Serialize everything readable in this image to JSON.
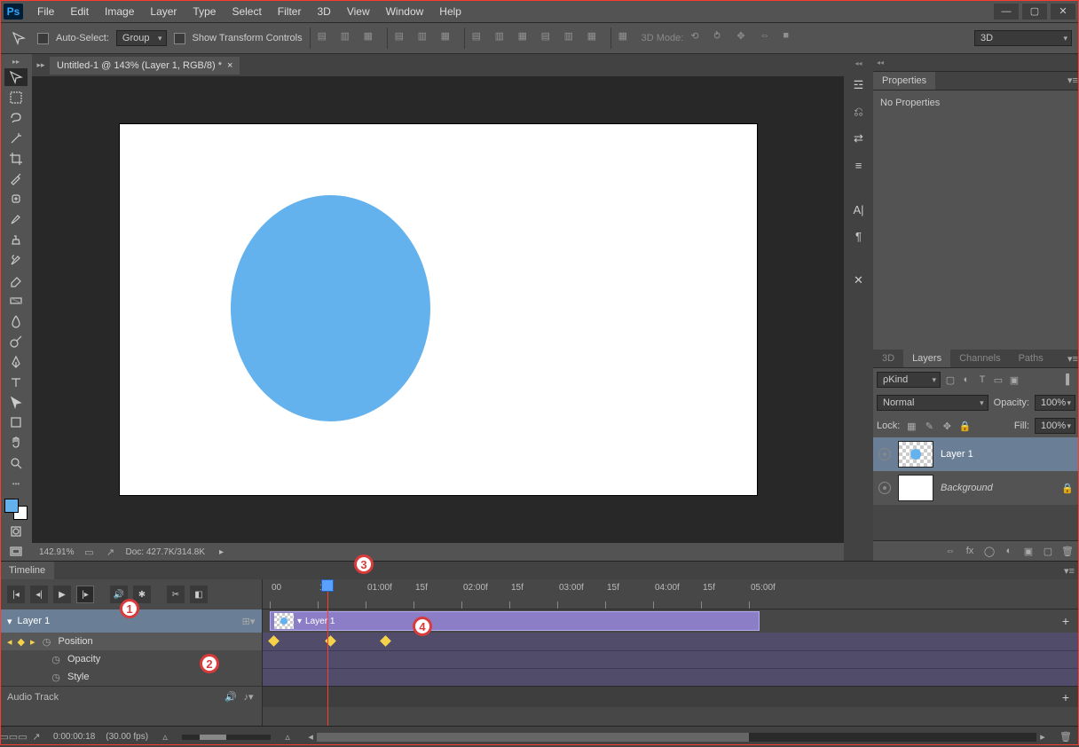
{
  "menubar": {
    "items": [
      "File",
      "Edit",
      "Image",
      "Layer",
      "Type",
      "Select",
      "Filter",
      "3D",
      "View",
      "Window",
      "Help"
    ]
  },
  "optionsbar": {
    "auto_select": "Auto-Select:",
    "group": "Group",
    "show_transform": "Show Transform Controls",
    "mode3d_label": "3D Mode:",
    "right_dropdown": "3D"
  },
  "doc": {
    "tab_title": "Untitled-1 @ 143% (Layer 1, RGB/8) *",
    "zoom": "142.91%",
    "docinfo": "Doc: 427.7K/314.8K"
  },
  "panels": {
    "properties_tab": "Properties",
    "no_properties": "No Properties",
    "layers_tabs": [
      "3D",
      "Layers",
      "Channels",
      "Paths"
    ],
    "kind": "Kind",
    "blend": "Normal",
    "opacity_label": "Opacity:",
    "opacity_val": "100%",
    "lock_label": "Lock:",
    "fill_label": "Fill:",
    "fill_val": "100%",
    "layer1": "Layer 1",
    "background": "Background"
  },
  "timeline": {
    "tab": "Timeline",
    "layer_label": "Layer 1",
    "props": {
      "position": "Position",
      "opacity": "Opacity",
      "style": "Style"
    },
    "audio": "Audio Track",
    "ticks": [
      "00",
      "15f",
      "01:00f",
      "15f",
      "02:00f",
      "15f",
      "03:00f",
      "15f",
      "04:00f",
      "15f",
      "05:00f"
    ],
    "clip_label": "Layer 1",
    "time": "0:00:00:18",
    "fps": "(30.00 fps)",
    "kind_search": "Kind"
  },
  "annotations": [
    "1",
    "2",
    "3",
    "4"
  ]
}
